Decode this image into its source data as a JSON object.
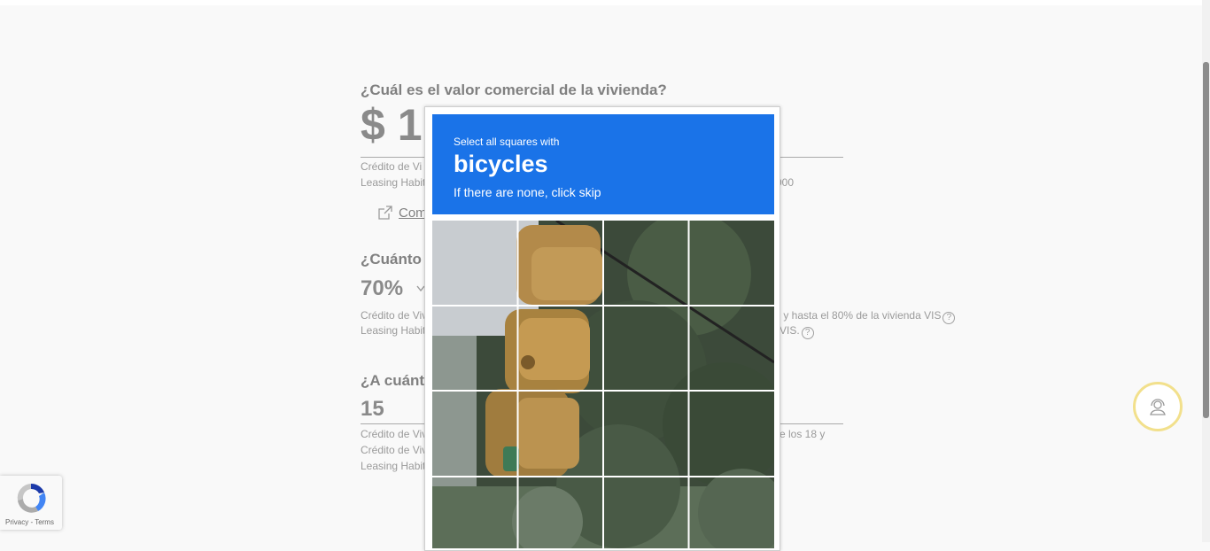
{
  "form": {
    "q1": {
      "question": "¿Cuál es el valor comercial de la vivienda?",
      "value": "$ 1",
      "note1": "Crédito de Vi",
      "note2": "Leasing Habit",
      "note_right": "000",
      "link_label": "Com"
    },
    "q2": {
      "question": "¿Cuánto d",
      "value": "70%",
      "note1": "Crédito de Viv",
      "note2": "Leasing Habit",
      "note1_right": "S y hasta el 80% de la vivienda VIS",
      "note2_right": "VIS."
    },
    "q3": {
      "question": "¿A cuánto",
      "value": "15",
      "note1": "Crédito de Viv",
      "note2": "Crédito de Viv",
      "note3": "Leasing Habit",
      "note1_right": "re los 18 y"
    }
  },
  "captcha": {
    "instruction": "Select all squares with",
    "target": "bicycles",
    "hint": "If there are none, click skip",
    "rows": 4,
    "cols": 4
  },
  "recaptcha_badge": {
    "terms": "Privacy - Terms"
  },
  "help_symbol": "?",
  "colors": {
    "captcha_blue": "#1a73e8",
    "support_ring": "#f2e08c"
  }
}
